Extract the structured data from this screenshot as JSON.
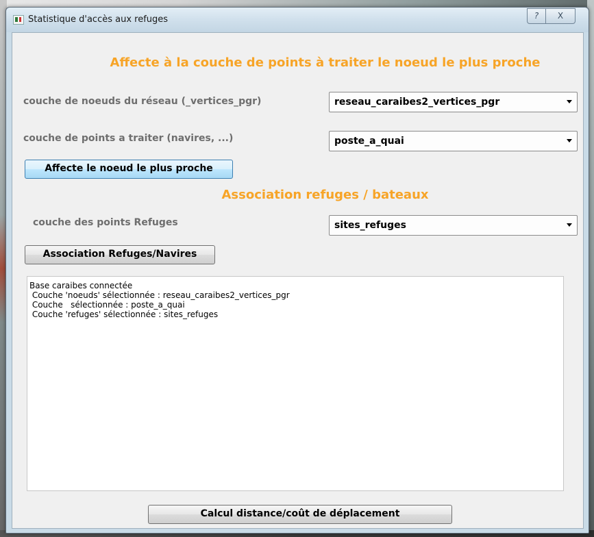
{
  "window": {
    "title": "Statistique d'accès aux refuges",
    "help_label": "?",
    "close_label": "X"
  },
  "section1": {
    "heading": "Affecte à la couche de points à traiter le noeud le plus proche",
    "nodes_label": "couche de noeuds du réseau (_vertices_pgr)",
    "nodes_value": "reseau_caraibes2_vertices_pgr",
    "points_label": "couche de points a traiter  (navires, ...)",
    "points_value": "poste_a_quai",
    "button_label": "Affecte le noeud le plus proche"
  },
  "section2": {
    "heading": "Association refuges / bateaux",
    "refuges_label": "couche des points Refuges",
    "refuges_value": "sites_refuges",
    "button_label": "Association Refuges/Navires"
  },
  "log": {
    "lines": [
      "Base caraibes connectée",
      " Couche 'noeuds' sélectionnée : reseau_caraibes2_vertices_pgr",
      " Couche   sélectionnée : poste_a_quai",
      " Couche 'refuges' sélectionnée : sites_refuges"
    ]
  },
  "footer": {
    "compute_button_label": "Calcul distance/coût de déplacement"
  },
  "colors": {
    "heading": "#f7a427",
    "label": "#6e6e6e",
    "focused_button": "#a7d9f5"
  }
}
